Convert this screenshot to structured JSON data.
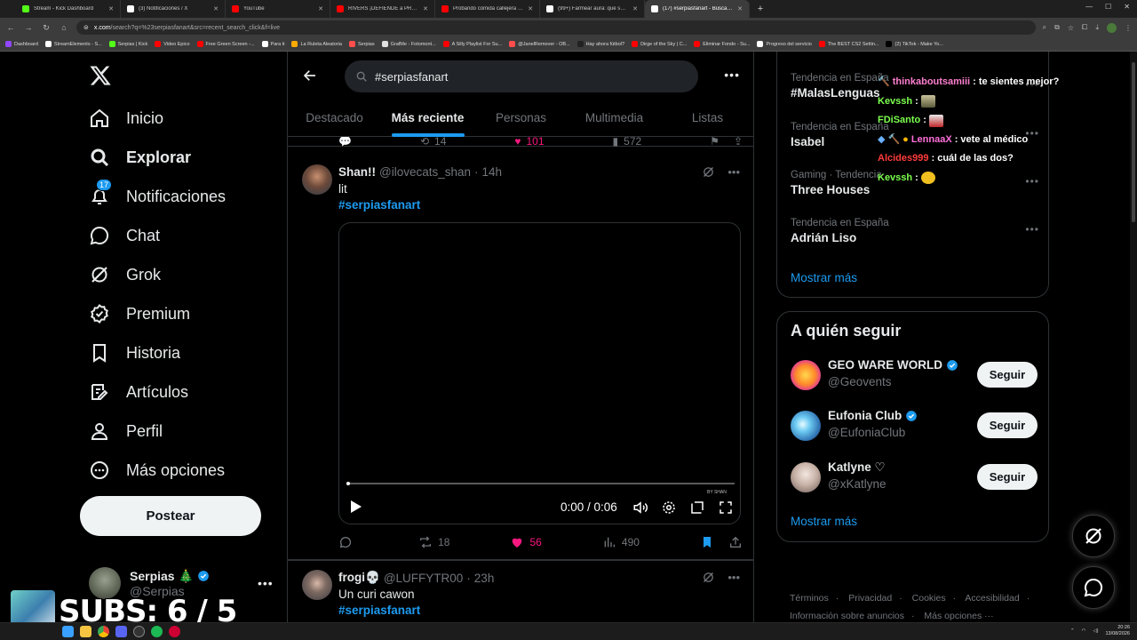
{
  "browser": {
    "tabs": [
      {
        "label": "Stream - Kick Dashboard",
        "color": "#53fc18"
      },
      {
        "label": "(3) Notificaciones / X",
        "color": "#ffffff"
      },
      {
        "label": "YouTube",
        "color": "#ff0000"
      },
      {
        "label": "RIVERS ¡DEFIENDE a PRODUCC...",
        "color": "#ff0000"
      },
      {
        "label": "Probando comida callejera en C...",
        "color": "#ff0000"
      },
      {
        "label": "(99+) Farmear aura: qué son y c...",
        "color": "#ffffff"
      },
      {
        "label": "(17) #serpiasfanart - Buscar / X",
        "color": "#ffffff",
        "active": true
      }
    ],
    "url_host": "x.com",
    "url_path": "/search?q=%23serpiasfanart&src=recent_search_click&f=live",
    "bookmarks": [
      {
        "label": "Dashboard",
        "color": "#9146ff"
      },
      {
        "label": "StreamElements - S...",
        "color": "#ffffff"
      },
      {
        "label": "Serpias | Kick",
        "color": "#53fc18"
      },
      {
        "label": "Video Epico",
        "color": "#ff0000"
      },
      {
        "label": "Free Green Screen -...",
        "color": "#ff0000"
      },
      {
        "label": "Para ti",
        "color": "#ffffff"
      },
      {
        "label": "La Ruleta Aleatoria",
        "color": "#ffaa00"
      },
      {
        "label": "Serpias",
        "color": "#ff4d4d"
      },
      {
        "label": "GrafMe - Fotomont...",
        "color": "#e0e0e0"
      },
      {
        "label": "A Silly Playlist For Su...",
        "color": "#ff0000"
      },
      {
        "label": "@JanelRemover - OB...",
        "color": "#ff4d4d"
      },
      {
        "label": "Hay ahora fútbol?",
        "color": "#222222"
      },
      {
        "label": "Dirge of the Sky | C...",
        "color": "#ff0000"
      },
      {
        "label": "Eliminar Fondo - Su...",
        "color": "#ff0000"
      },
      {
        "label": "Progreso del servicio",
        "color": "#ffffff"
      },
      {
        "label": "The BEST CS2 Settin...",
        "color": "#ff0000"
      },
      {
        "label": "(2) TikTok - Make Yo...",
        "color": "#000000"
      }
    ]
  },
  "sidebar": {
    "items": [
      {
        "label": "Inicio",
        "icon": "home-icon"
      },
      {
        "label": "Explorar",
        "icon": "search-icon",
        "active": true
      },
      {
        "label": "Notificaciones",
        "icon": "bell-icon",
        "badge": "17"
      },
      {
        "label": "Chat",
        "icon": "chat-icon"
      },
      {
        "label": "Grok",
        "icon": "grok-icon"
      },
      {
        "label": "Premium",
        "icon": "premium-icon"
      },
      {
        "label": "Historia",
        "icon": "bookmark-icon"
      },
      {
        "label": "Artículos",
        "icon": "article-icon"
      },
      {
        "label": "Perfil",
        "icon": "profile-icon"
      },
      {
        "label": "Más opciones",
        "icon": "more-icon"
      }
    ],
    "post_label": "Postear",
    "account_name": "Serpias 🎄",
    "account_handle": "@Serpias"
  },
  "stream_overlay": {
    "subs_text": "SUBS: 6 / 5"
  },
  "search": {
    "query": "#serpiasfanart",
    "tabs": [
      "Destacado",
      "Más reciente",
      "Personas",
      "Multimedia",
      "Listas"
    ],
    "active_tab": "Más reciente"
  },
  "prev_tweet_actions": {
    "retweets": "14",
    "likes": "101",
    "views": "572"
  },
  "tweets": [
    {
      "name": "Shan!!",
      "handle": "@ilovecats_shan",
      "time": "14h",
      "text": "lit",
      "hashtag": "#serpiasfanart",
      "video": {
        "time": "0:00 / 0:06",
        "watermark": "BY SHAN",
        "progress": 0
      },
      "replies": "",
      "retweets": "18",
      "likes": "56",
      "views": "490"
    },
    {
      "name": "frogi💀",
      "handle": "@LUFFYTR00",
      "time": "23h",
      "text": "Un curi cawon",
      "hashtag": "#serpiasfanart"
    }
  ],
  "trends": [
    {
      "meta": "Tendencia en España",
      "name": "#MalasLenguas"
    },
    {
      "meta": "Tendencia en España",
      "name": "Isabel"
    },
    {
      "meta": "Gaming · Tendencia",
      "name": "Three Houses"
    },
    {
      "meta": "Tendencia en España",
      "name": "Adrián Liso"
    }
  ],
  "trends_show_more": "Mostrar más",
  "who_to_follow": {
    "title": "A quién seguir",
    "follow_label": "Seguir",
    "accounts": [
      {
        "name": "GEO WARE WORLD",
        "handle": "@Geovents",
        "verified": true
      },
      {
        "name": "Eufonia Club",
        "handle": "@EufoniaClub",
        "verified": true
      },
      {
        "name": "Katlyne ♡",
        "handle": "@xKatlyne",
        "verified": false
      }
    ],
    "show_more": "Mostrar más"
  },
  "footer": {
    "links": [
      "Términos",
      "Privacidad",
      "Cookies",
      "Accesibilidad",
      "Información sobre anuncios",
      "Más opciones ···"
    ]
  },
  "chat": [
    {
      "user": "thinkaboutsamiii",
      "color": "#ff7fd0",
      "msg": ": te sientes mejor?"
    },
    {
      "user": "Kevssh",
      "color": "#7cff4f",
      "msg": ":"
    },
    {
      "user": "FDiSanto",
      "color": "#7cff4f",
      "msg": ":"
    },
    {
      "user": "LennaaX",
      "color": "#ff6fd8",
      "msg": ": vete al médico"
    },
    {
      "user": "Alcides999",
      "color": "#ff3b3b",
      "msg": ": cuál de las dos?"
    },
    {
      "user": "Kevssh",
      "color": "#7cff4f",
      "msg": ":"
    }
  ],
  "taskbar": {
    "time": "20:26",
    "date": "13/08/2026"
  }
}
